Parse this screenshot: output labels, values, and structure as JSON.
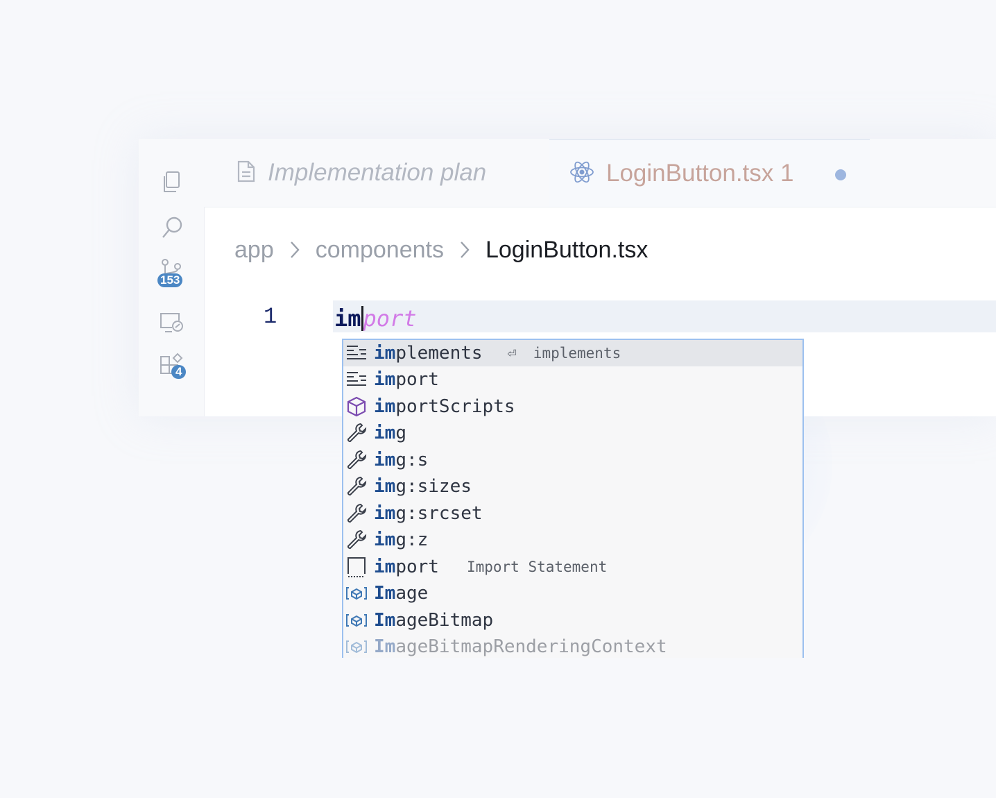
{
  "activity_bar": {
    "items": [
      {
        "icon": "files-icon"
      },
      {
        "icon": "search-icon"
      },
      {
        "icon": "source-control-icon",
        "badge": "153"
      },
      {
        "icon": "remote-explorer-icon"
      },
      {
        "icon": "extensions-icon",
        "badge": "4"
      }
    ]
  },
  "tabs": [
    {
      "label": "Implementation plan",
      "icon": "document-icon",
      "active": false
    },
    {
      "label": "LoginButton.tsx 1",
      "icon": "react-icon",
      "active": true,
      "modified": true
    }
  ],
  "breadcrumb": {
    "items": [
      "app",
      "components",
      "LoginButton.tsx"
    ]
  },
  "editor": {
    "line_number": "1",
    "typed_text": "im",
    "ghost_text": "port"
  },
  "suggestions": {
    "items": [
      {
        "icon": "keyword-snippet-icon",
        "match": "im",
        "rest": "plements",
        "hint_key": "⏎",
        "detail": "implements",
        "selected": true
      },
      {
        "icon": "keyword-snippet-icon",
        "match": "im",
        "rest": "port",
        "detail": ""
      },
      {
        "icon": "module-cube-icon",
        "match": "im",
        "rest": "portScripts",
        "detail": ""
      },
      {
        "icon": "wrench-icon",
        "match": "im",
        "rest": "g",
        "detail": ""
      },
      {
        "icon": "wrench-icon",
        "match": "im",
        "rest": "g:s",
        "detail": ""
      },
      {
        "icon": "wrench-icon",
        "match": "im",
        "rest": "g:sizes",
        "detail": ""
      },
      {
        "icon": "wrench-icon",
        "match": "im",
        "rest": "g:srcset",
        "detail": ""
      },
      {
        "icon": "wrench-icon",
        "match": "im",
        "rest": "g:z",
        "detail": ""
      },
      {
        "icon": "snippet-box-icon",
        "match": "im",
        "rest": "port",
        "detail": "Import Statement"
      },
      {
        "icon": "variable-icon",
        "match": "Im",
        "rest": "age",
        "detail": ""
      },
      {
        "icon": "variable-icon",
        "match": "Im",
        "rest": "ageBitmap",
        "detail": ""
      },
      {
        "icon": "variable-icon",
        "match": "Im",
        "rest": "ageBitmapRenderingContext",
        "detail": ""
      }
    ]
  },
  "colors": {
    "accent": "#4b87c4",
    "ghost_text": "#d27be7",
    "match_highlight": "#1f4d8f",
    "suggest_border": "#9cc0ef"
  }
}
